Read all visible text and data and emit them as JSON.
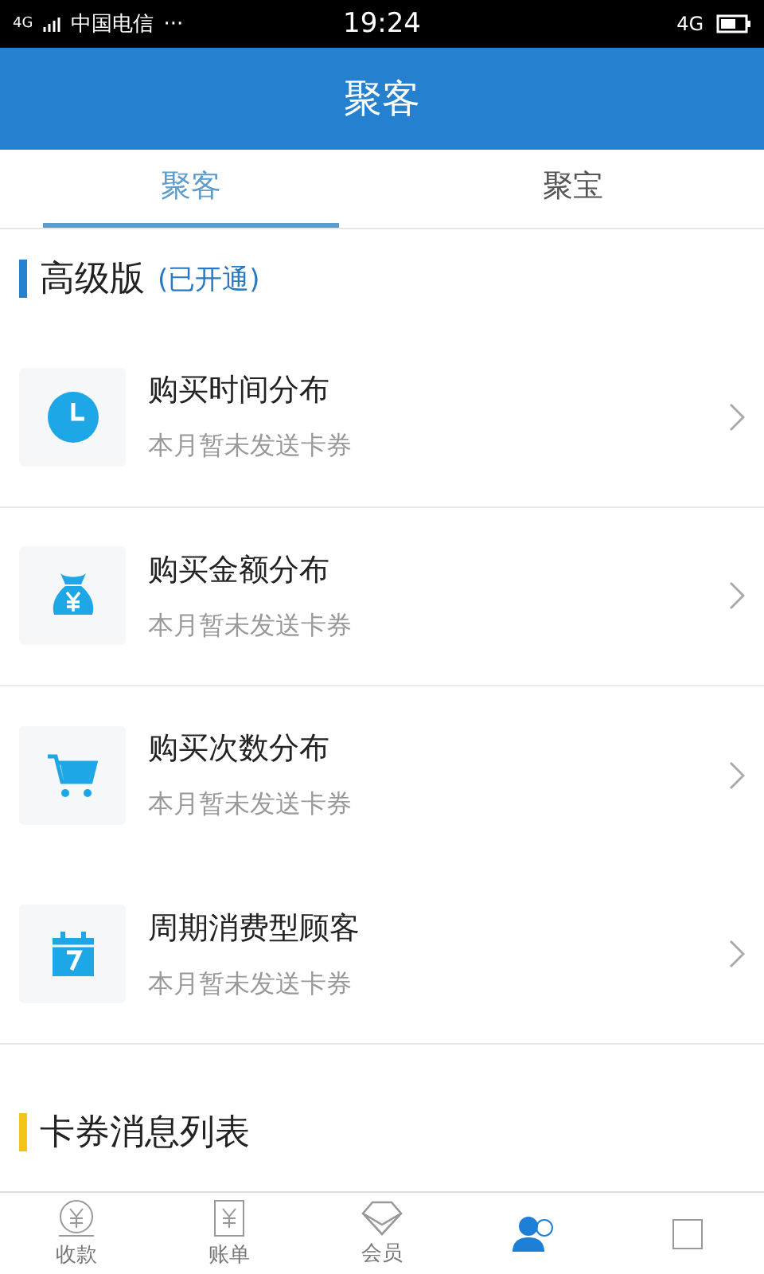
{
  "status_bar": {
    "network": "4G",
    "carrier": "中国电信",
    "dots": "···",
    "time": "19:24",
    "mobile": "4G"
  },
  "header": {
    "title": "聚客"
  },
  "tabs": [
    {
      "label": "聚客",
      "selected": true
    },
    {
      "label": "聚宝",
      "selected": false
    }
  ],
  "section": {
    "title": "高级版",
    "note": "(已开通)"
  },
  "items": [
    {
      "kind": "clock",
      "title": "购买时间分布",
      "subtitle": "本月暂未发送卡券",
      "divider": true
    },
    {
      "kind": "moneybag",
      "title": "购买金额分布",
      "subtitle": "本月暂未发送卡券",
      "divider": true
    },
    {
      "kind": "cart",
      "title": "购买次数分布",
      "subtitle": "本月暂未发送卡券",
      "divider": false
    },
    {
      "kind": "calendar",
      "title": "周期消费型顾客",
      "subtitle": "本月暂未发送卡券",
      "divider": true
    }
  ],
  "section2": {
    "title": "卡券消息列表"
  },
  "bottom_nav": [
    {
      "kind": "coin",
      "label": "收款",
      "selected": false
    },
    {
      "kind": "bill",
      "label": "账单",
      "selected": false
    },
    {
      "kind": "diamond",
      "label": "会员",
      "selected": false
    },
    {
      "kind": "people",
      "selected": true
    },
    {
      "kind": "box",
      "selected": false
    }
  ]
}
